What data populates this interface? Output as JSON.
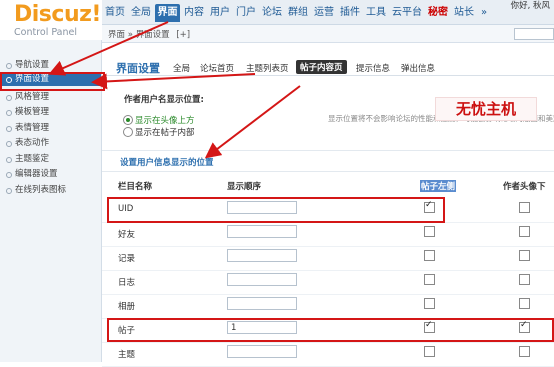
{
  "logo": {
    "brand": "Discuz!",
    "subtitle": "Control Panel"
  },
  "topnav": {
    "tabs": [
      {
        "label": "首页"
      },
      {
        "label": "全局"
      },
      {
        "label": "界面",
        "active": true
      },
      {
        "label": "内容"
      },
      {
        "label": "用户"
      },
      {
        "label": "门户"
      },
      {
        "label": "论坛"
      },
      {
        "label": "群组"
      },
      {
        "label": "运营"
      },
      {
        "label": "插件"
      },
      {
        "label": "工具"
      },
      {
        "label": "云平台"
      },
      {
        "label": "秘密",
        "highlight": "#cc0000"
      },
      {
        "label": "站长"
      },
      {
        "label": "»"
      }
    ],
    "user_greeting": "你好, 秋风"
  },
  "breadcrumb": {
    "text": "界面 » 界面设置",
    "plus": "[+]"
  },
  "sidebar": {
    "items": [
      {
        "label": "导航设置"
      },
      {
        "label": "界面设置",
        "active": true
      },
      {
        "label": "风格管理"
      },
      {
        "label": "模板管理"
      },
      {
        "label": "表情管理"
      },
      {
        "label": "表态动作"
      },
      {
        "label": "主题鉴定"
      },
      {
        "label": "编辑器设置"
      },
      {
        "label": "在线列表图标"
      }
    ]
  },
  "main": {
    "section_title": "界面设置",
    "subtabs": [
      "全局",
      "论坛首页",
      "主题列表页",
      "帖子内容页",
      "提示信息",
      "弹出信息"
    ],
    "current_subtab": "帖子内容页",
    "author_position_label": "作者用户名显示位置:",
    "radio_options": [
      {
        "label": "显示在头像上方",
        "checked": true
      },
      {
        "label": "显示在帖子内部",
        "checked": false
      }
    ],
    "position_note": "显示位置将不会影响论坛的性能和速度，可能会影响论坛的版面和美观",
    "watermark": "无忧主机",
    "settings_header": "设置用户信息显示的位置",
    "columns": [
      "栏目名称",
      "显示顺序",
      "帖子左侧",
      "作者头像下"
    ],
    "rows": [
      {
        "name": "UID",
        "order": "",
        "left": true,
        "under_avatar": false
      },
      {
        "name": "好友",
        "order": "",
        "left": false,
        "under_avatar": false
      },
      {
        "name": "记录",
        "order": "",
        "left": false,
        "under_avatar": false
      },
      {
        "name": "日志",
        "order": "",
        "left": false,
        "under_avatar": false
      },
      {
        "name": "相册",
        "order": "",
        "left": false,
        "under_avatar": false
      },
      {
        "name": "帖子",
        "order": "1",
        "left": true,
        "under_avatar": true
      },
      {
        "name": "主题",
        "order": "",
        "left": false,
        "under_avatar": false
      }
    ]
  },
  "colors": {
    "accent": "#2d6fae",
    "logo": "#f29b1e",
    "annotation": "#d41616"
  }
}
